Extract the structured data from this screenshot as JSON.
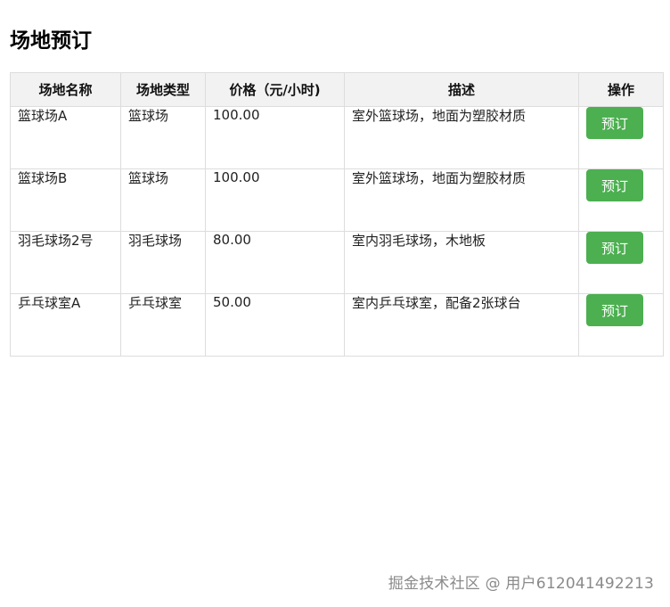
{
  "page": {
    "title": "场地预订"
  },
  "table": {
    "headers": {
      "name": "场地名称",
      "type": "场地类型",
      "price": "价格（元/小时)",
      "description": "描述",
      "action": "操作"
    },
    "rows": [
      {
        "name": "篮球场A",
        "type": "篮球场",
        "price": "100.00",
        "description": "室外篮球场，地面为塑胶材质",
        "action_label": "预订"
      },
      {
        "name": "篮球场B",
        "type": "篮球场",
        "price": "100.00",
        "description": "室外篮球场，地面为塑胶材质",
        "action_label": "预订"
      },
      {
        "name": "羽毛球场2号",
        "type": "羽毛球场",
        "price": "80.00",
        "description": "室内羽毛球场，木地板",
        "action_label": "预订"
      },
      {
        "name": "乒乓球室A",
        "type": "乒乓球室",
        "price": "50.00",
        "description": "室内乒乓球室，配备2张球台",
        "action_label": "预订"
      }
    ]
  },
  "watermark": {
    "text": "掘金技术社区 @ 用户612041492213"
  },
  "colors": {
    "button_bg": "#4caf50",
    "header_bg": "#f2f2f2",
    "border": "#dddddd"
  }
}
